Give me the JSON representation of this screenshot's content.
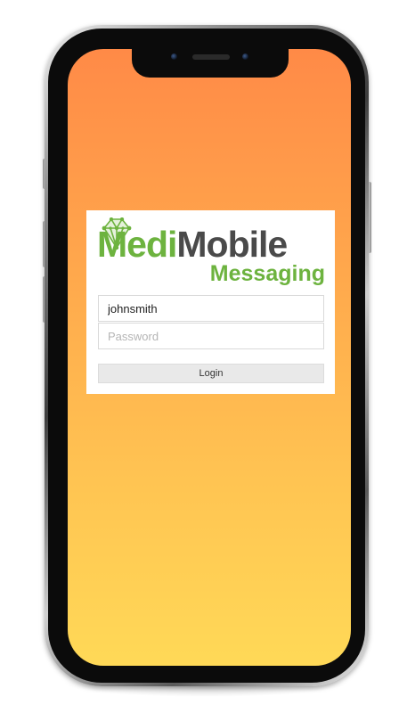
{
  "app": {
    "logo": {
      "word_primary": "Medi",
      "word_secondary": "Mobile",
      "subtitle": "Messaging",
      "icon": "gem-network-icon",
      "primary_color": "#6db33f",
      "secondary_color": "#4a4a4a"
    }
  },
  "login_form": {
    "username": {
      "value": "johnsmith",
      "placeholder": ""
    },
    "password": {
      "value": "",
      "placeholder": "Password"
    },
    "submit_label": "Login"
  },
  "theme": {
    "background_gradient": [
      "#ff8a47",
      "#ffd957"
    ]
  }
}
